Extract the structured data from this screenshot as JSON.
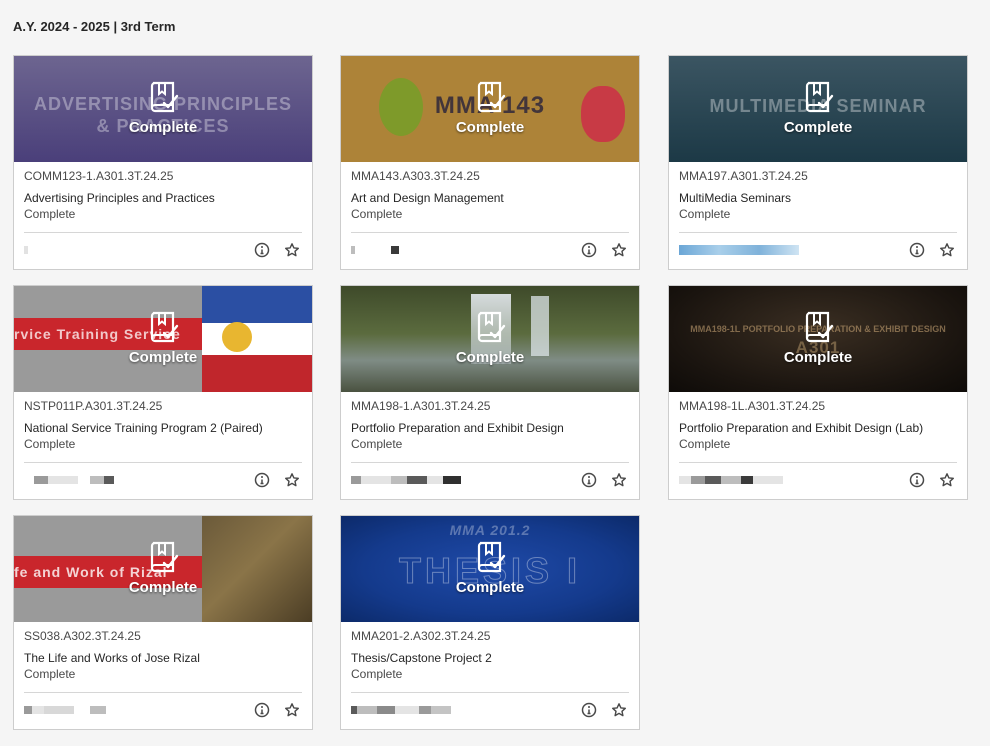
{
  "term": "A.Y. 2024 - 2025 | 3rd Term",
  "overlay_label": "Complete",
  "colors": {
    "accent": "#262626",
    "border": "#cdcdcd"
  },
  "icons": {
    "overlay": "book-check-icon",
    "info": "info-icon",
    "favorite": "star-icon"
  },
  "courses": [
    {
      "code": "COMM123-1.A301.3T.24.25",
      "name": "Advertising Principles and Practices",
      "status": "Complete"
    },
    {
      "code": "MMA143.A303.3T.24.25",
      "name": "Art and Design Management",
      "status": "Complete"
    },
    {
      "code": "MMA197.A301.3T.24.25",
      "name": "MultiMedia Seminars",
      "status": "Complete"
    },
    {
      "code": "NSTP011P.A301.3T.24.25",
      "name": "National Service Training Program 2 (Paired)",
      "status": "Complete"
    },
    {
      "code": "MMA198-1.A301.3T.24.25",
      "name": "Portfolio Preparation and Exhibit Design",
      "status": "Complete"
    },
    {
      "code": "MMA198-1L.A301.3T.24.25",
      "name": "Portfolio Preparation and Exhibit Design (Lab)",
      "status": "Complete"
    },
    {
      "code": "SS038.A302.3T.24.25",
      "name": "The Life and Works of Jose Rizal",
      "status": "Complete"
    },
    {
      "code": "MMA201-2.A302.3T.24.25",
      "name": "Thesis/Capstone Project 2",
      "status": "Complete"
    }
  ]
}
